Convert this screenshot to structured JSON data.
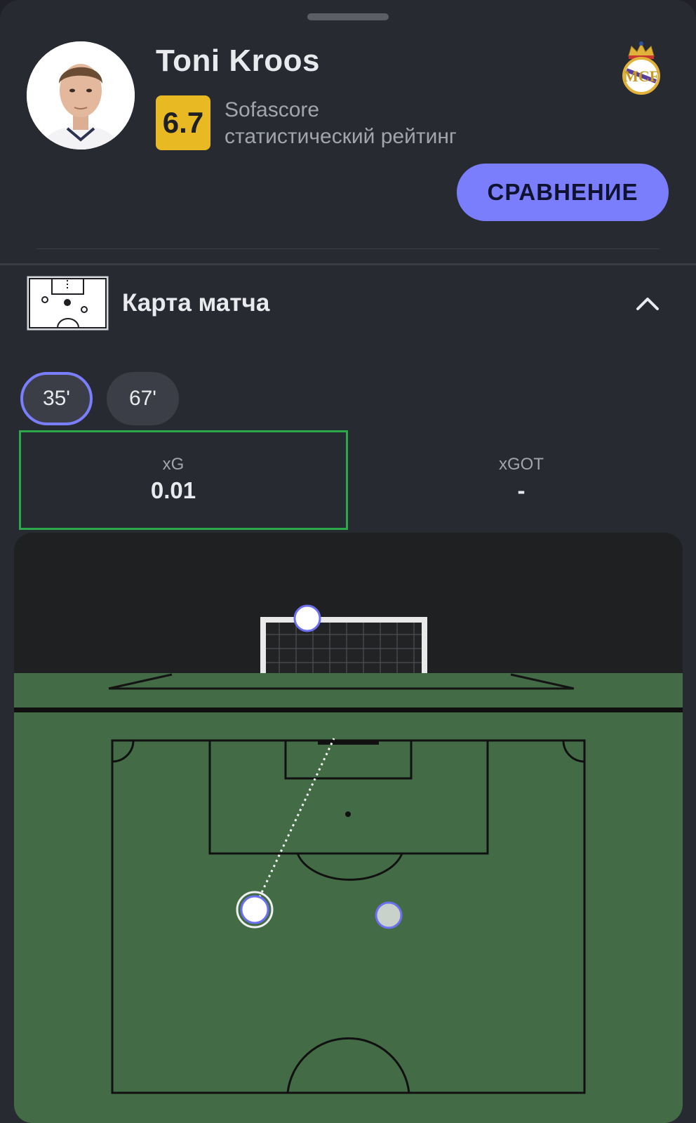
{
  "player": {
    "name": "Toni Kroos",
    "rating": "6.7",
    "rating_source": "Sofascore",
    "rating_description": "статистический рейтинг"
  },
  "actions": {
    "compare_label": "СРАВНЕНИЕ"
  },
  "match_map": {
    "title": "Карта матча",
    "shots": [
      {
        "label": "35'",
        "selected": true
      },
      {
        "label": "67'",
        "selected": false
      }
    ],
    "stats": {
      "xg_label": "xG",
      "xg_value": "0.01",
      "xgot_label": "xGOT",
      "xgot_value": "-"
    }
  },
  "colors": {
    "accent": "#7a7efc",
    "rating_badge": "#e8b923",
    "highlight_border": "#2aa84a",
    "pitch": "#436c46",
    "background": "#272a31"
  },
  "icons": {
    "collapse": "chevron-up-icon",
    "section": "pitch-map-icon",
    "club": "real-madrid-crest-icon"
  }
}
